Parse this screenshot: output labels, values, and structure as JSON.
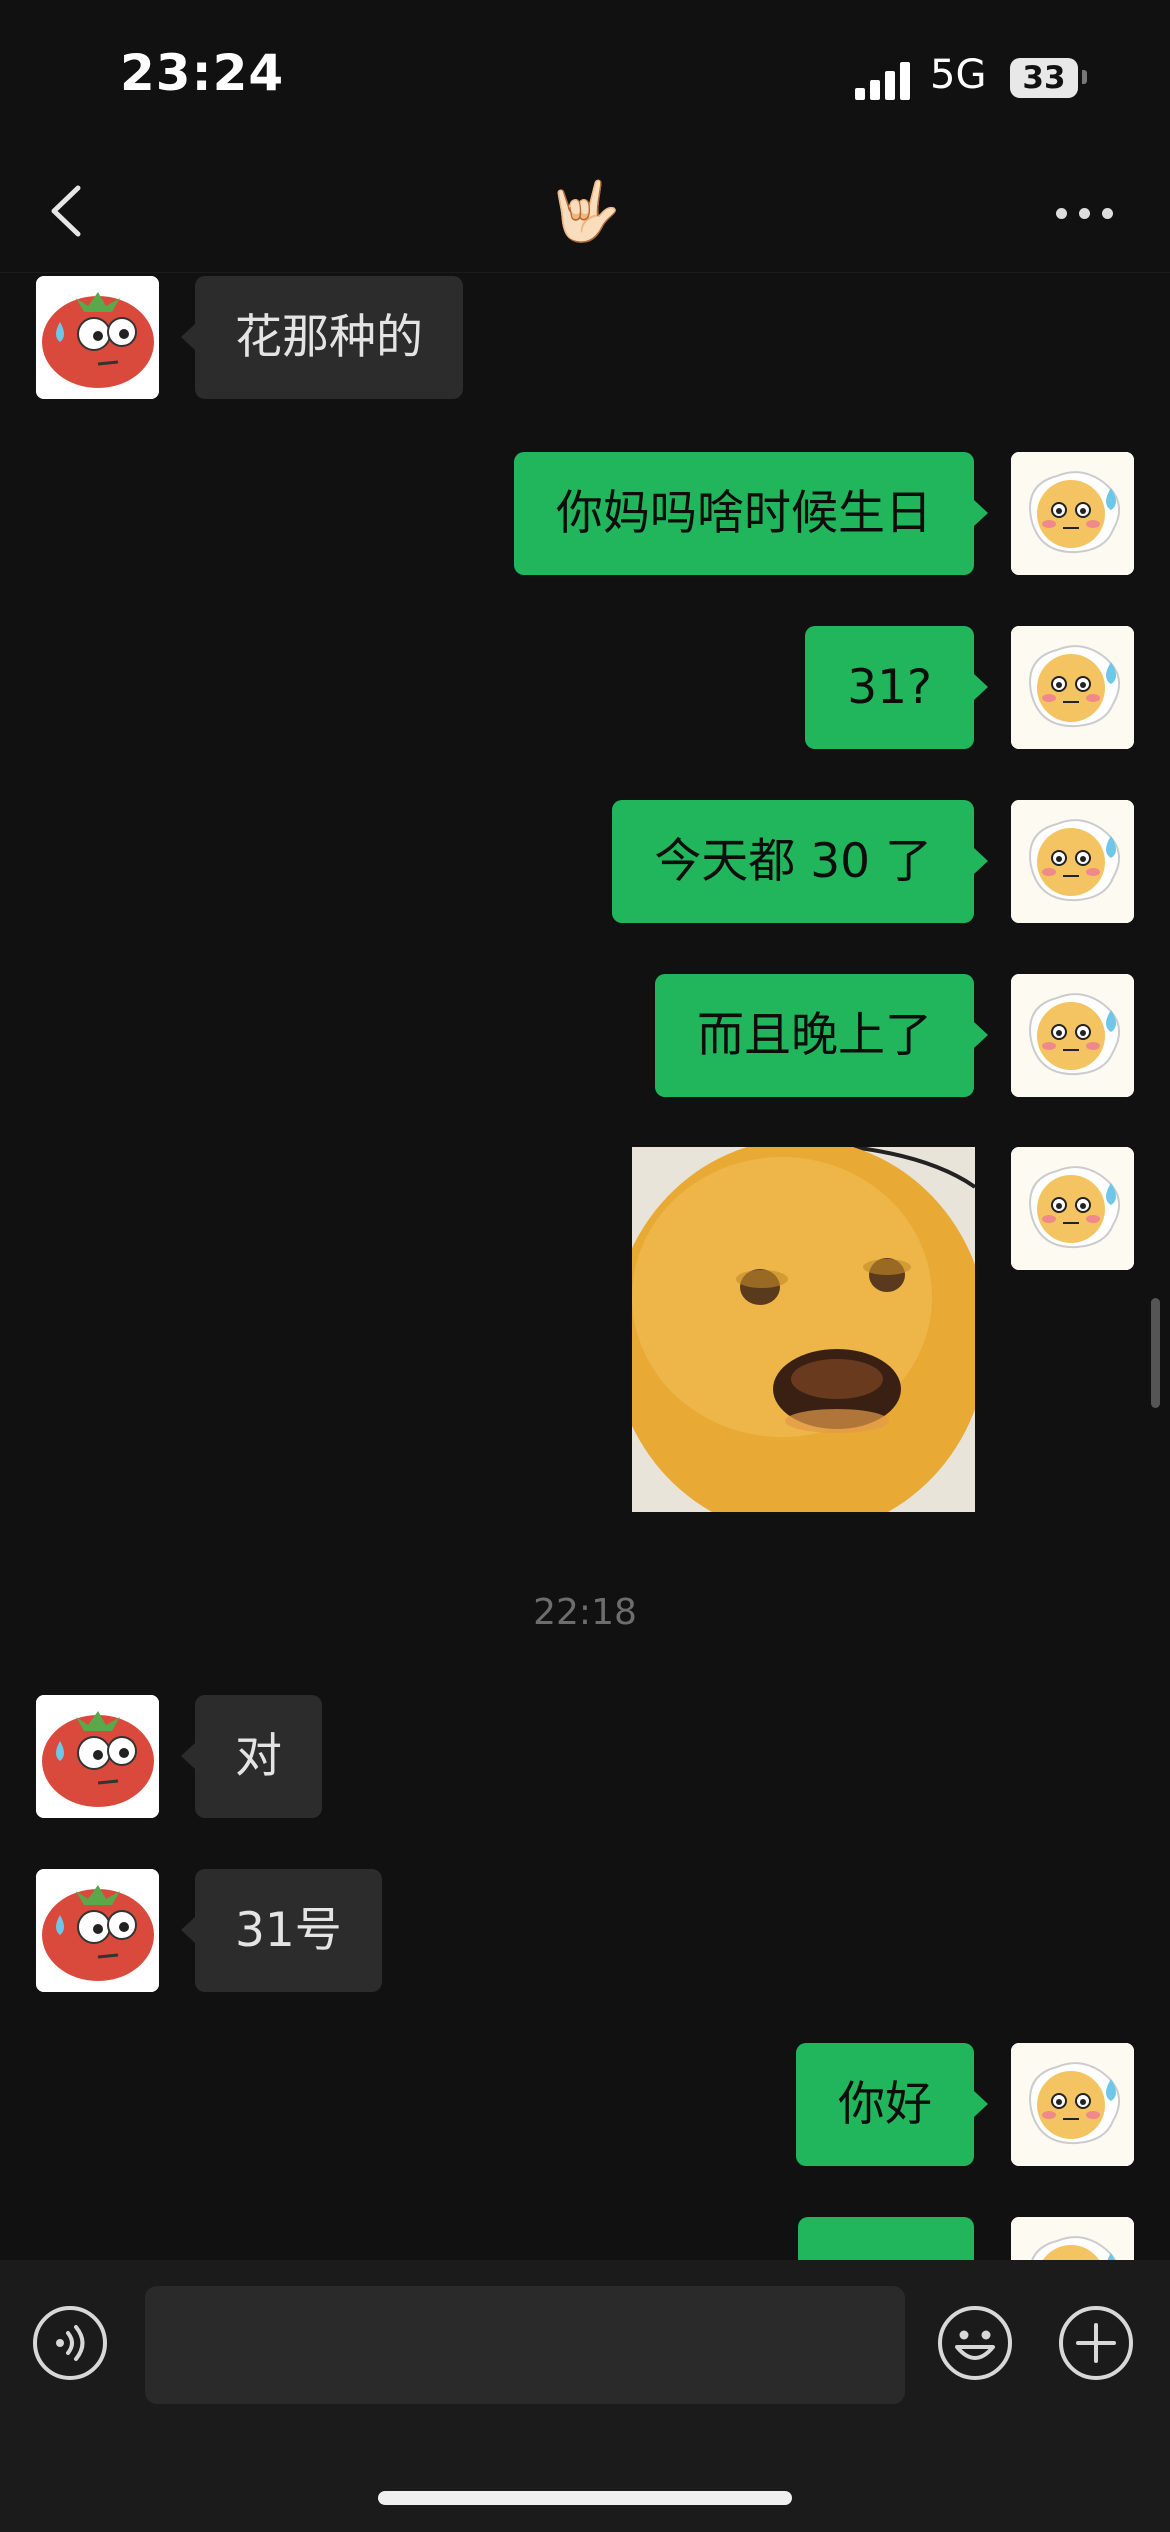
{
  "status_bar": {
    "time": "23:24",
    "network": "5G",
    "battery": "33"
  },
  "nav": {
    "title": "🤟🏻"
  },
  "messages": [
    {
      "side": "in",
      "text": "花那种的"
    },
    {
      "side": "out",
      "text": "你妈吗啥时候生日"
    },
    {
      "side": "out",
      "text": "31?"
    },
    {
      "side": "out",
      "text": "今天都 30 了"
    },
    {
      "side": "out",
      "text": "而且晚上了"
    },
    {
      "side": "out",
      "sticker": "orange-face-sticker"
    },
    {
      "timestamp": "22:18"
    },
    {
      "side": "in",
      "text": "对"
    },
    {
      "side": "in",
      "text": "31号"
    },
    {
      "side": "out",
      "text": "你好"
    }
  ],
  "icons": {
    "back": "chevron-left-icon",
    "more": "more-dots-icon",
    "voice": "voice-icon",
    "emoji": "emoji-icon",
    "add": "plus-icon"
  },
  "colors": {
    "outgoing_bubble": "#21b65c",
    "incoming_bubble": "#2c2c2c",
    "background": "#111111"
  }
}
